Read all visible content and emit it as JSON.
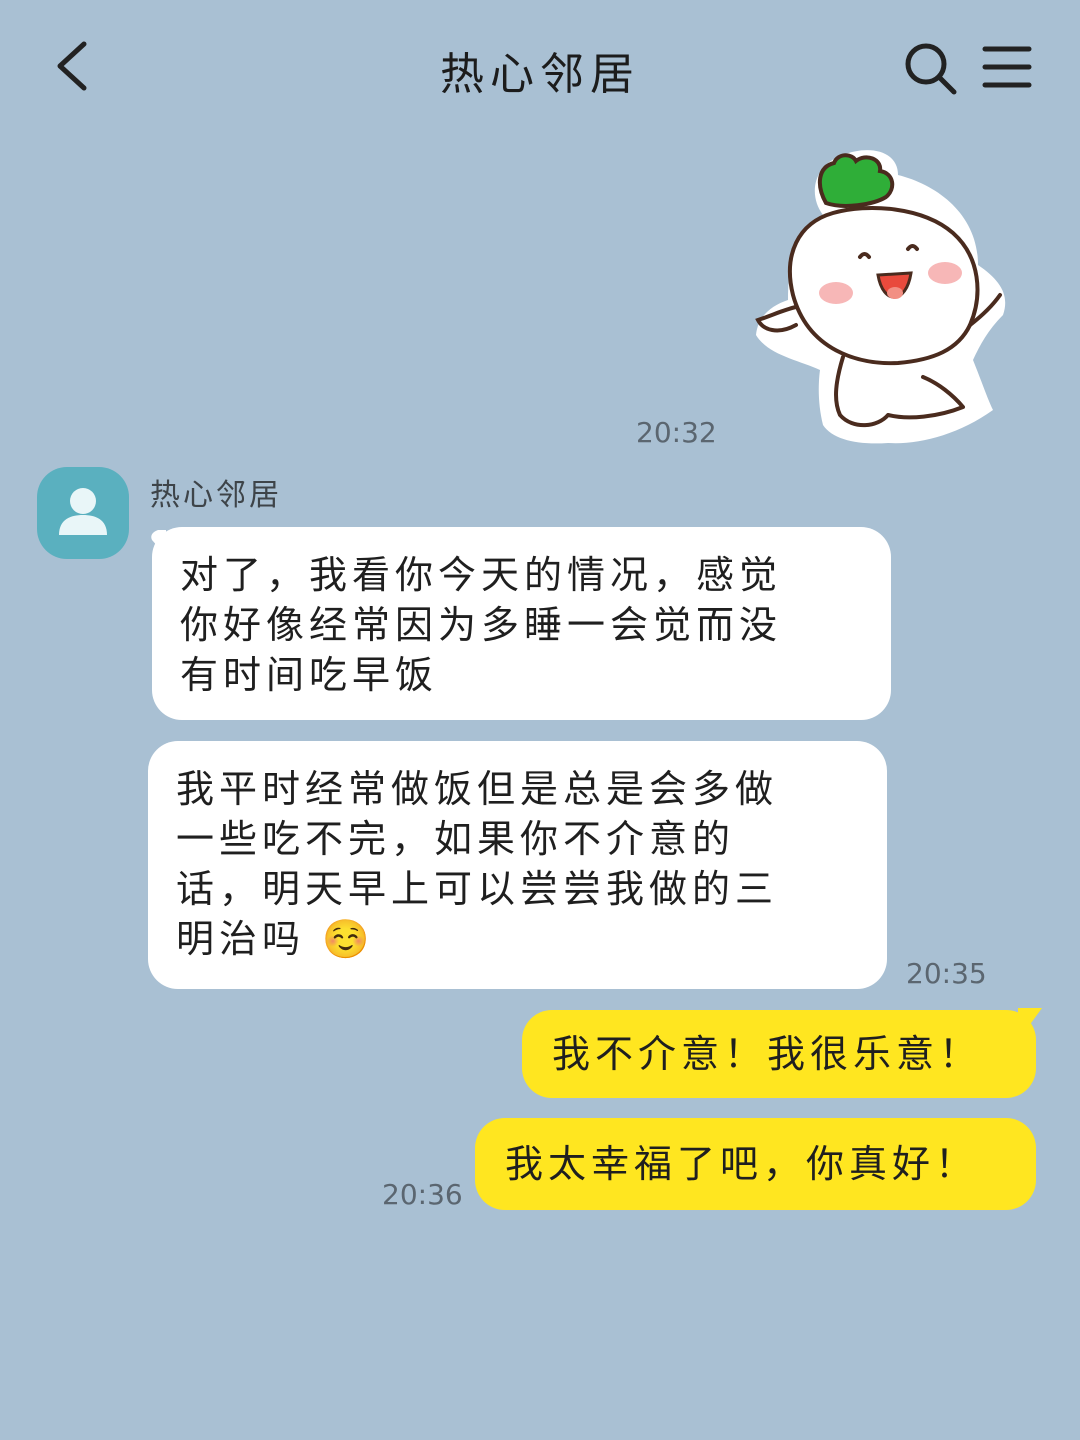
{
  "header": {
    "title": "热心邻居",
    "back_icon": "chevron-left-icon",
    "search_icon": "search-icon",
    "menu_icon": "hamburger-menu-icon"
  },
  "colors": {
    "background": "#a9c0d3",
    "incoming_bubble": "#ffffff",
    "outgoing_bubble": "#ffe620",
    "avatar": "#5ab0bf"
  },
  "messages": {
    "sticker": {
      "name": "radish-sticker",
      "time": "20:32"
    },
    "sender": "热心邻居",
    "incoming_1": {
      "lines": [
        "对了，我看你今天的情况，感觉",
        "你好像经常因为多睡一会觉而没",
        "有时间吃早饭"
      ]
    },
    "incoming_2": {
      "lines": [
        "我平时经常做饭但是总是会多做",
        "一些吃不完，如果你不介意的",
        "话，明天早上可以尝尝我做的三",
        "明治吗"
      ],
      "emoji": "☺️",
      "time": "20:35"
    },
    "outgoing_1": {
      "text": "我不介意！我很乐意！"
    },
    "outgoing_2": {
      "text": "我太幸福了吧，你真好！",
      "time": "20:36"
    }
  }
}
